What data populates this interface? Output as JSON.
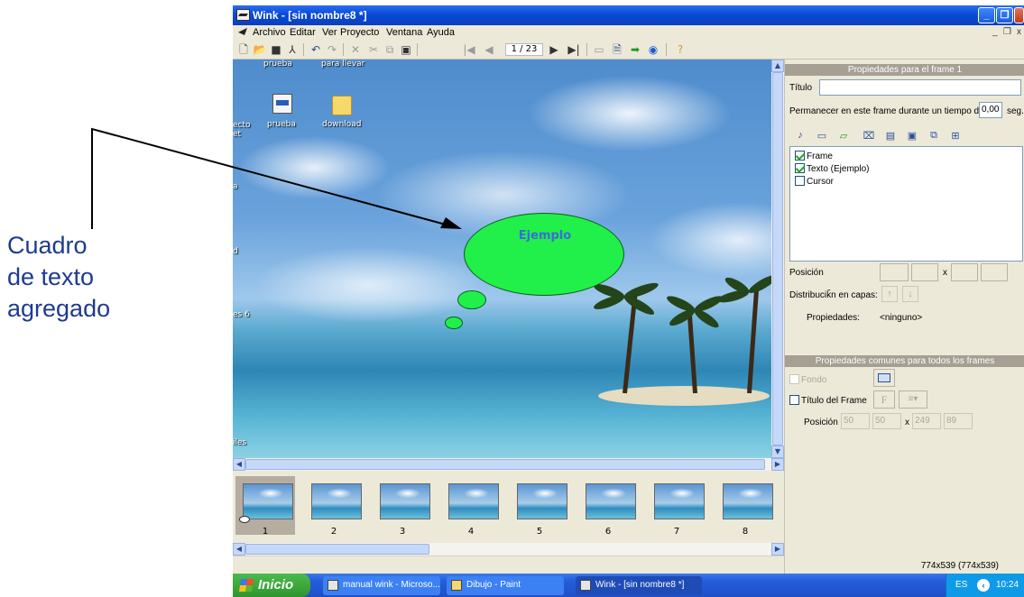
{
  "annotation": {
    "lines": [
      "Cuadro",
      "de texto",
      "agregado"
    ]
  },
  "window": {
    "title": "Wink - [sin nombre8 *]",
    "controls": {
      "minimize": "_",
      "maximize": "❐",
      "close": "✕"
    }
  },
  "menu": {
    "items": [
      "Archivo",
      "Editar",
      "Ver",
      "Proyecto",
      "Ventana",
      "Ayuda"
    ],
    "mdi_controls": {
      "minimize": "_",
      "restore": "❐",
      "close": "x"
    }
  },
  "toolbar": {
    "frame_counter": "1 / 23",
    "icons": [
      "new-icon",
      "open-icon",
      "save-icon",
      "render-icon",
      "undo-icon",
      "redo-icon",
      "delete-icon",
      "cut-icon",
      "copy-icon",
      "paste-icon",
      "first-frame-icon",
      "previous-frame-icon",
      "next-frame-icon",
      "last-frame-icon",
      "screen-icon",
      "document-icon",
      "export-arrow-icon",
      "globe-icon",
      "help-icon"
    ]
  },
  "canvas": {
    "desktop_icons": [
      {
        "label": "prueba",
        "icon": "archive-icon"
      },
      {
        "label": "download",
        "icon": "folder-icon"
      }
    ],
    "top_labels": [
      "prueba",
      "para llevar"
    ],
    "edge_labels": [
      "ecto",
      "et",
      "a",
      "d",
      "es 6",
      "iles"
    ],
    "bubble_text": "Ejemplo"
  },
  "filmstrip": {
    "frames": [
      "1",
      "2",
      "3",
      "4",
      "5",
      "6",
      "7",
      "8"
    ],
    "selected_frame": "1"
  },
  "panel": {
    "frame_header": "Propiedades para el frame 1",
    "title_label": "Título",
    "title_value": "",
    "stay_label": "Permanecer en este frame durante un tiempo de",
    "stay_value": "0,00",
    "stay_unit": "seg.",
    "tool_icons": [
      "sound-icon",
      "text-box-icon",
      "image-icon",
      "text-button-icon",
      "button-icon",
      "button-image-icon",
      "link-icon",
      "navigation-icon"
    ],
    "layers": [
      {
        "label": "Frame",
        "checked": true
      },
      {
        "label": "Texto (Ejemplo)",
        "checked": true
      },
      {
        "label": "Cursor",
        "checked": false
      }
    ],
    "position_label": "Posición",
    "position_separator": "x",
    "distribution_label": "Distribuciǩn en capas:",
    "properties_label": "Propiedades:",
    "properties_value": "<ninguno>",
    "common_header": "Propiedades comunes para todos los frames",
    "background_label": "Fondo",
    "frame_title_label": "Título del Frame",
    "frame_title_font_glyph": "F",
    "common_position_label": "Posición",
    "common_position": [
      "50",
      "50",
      "249",
      "89"
    ],
    "common_separator": "x"
  },
  "status": {
    "size": "774x539 (774x539)"
  },
  "taskbar": {
    "start": "Inicio",
    "tasks": [
      {
        "label": "manual wink - Microso...",
        "active": false
      },
      {
        "label": "Dibujo - Paint",
        "active": false
      },
      {
        "label": "Wink - [sin nombre8 *]",
        "active": true
      }
    ],
    "language": "ES",
    "clock": "10:24"
  },
  "colors": {
    "titlebar": "#0a4ad6",
    "bubble": "#21f04a",
    "bubble_text": "#3b6dd9",
    "annotation_text": "#1f3b8f",
    "panel_header": "#a59f94"
  }
}
